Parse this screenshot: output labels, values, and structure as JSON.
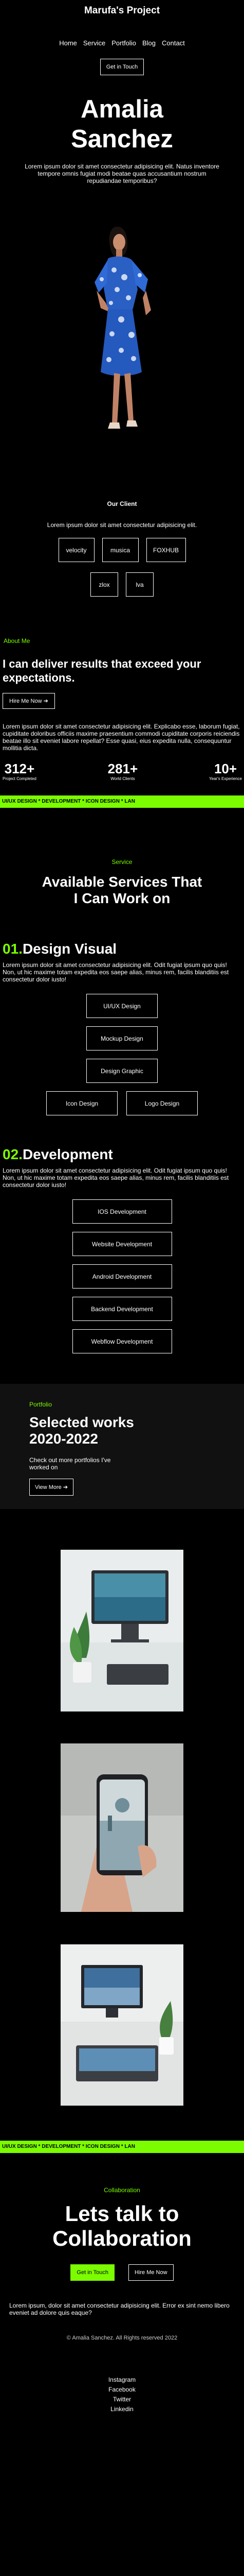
{
  "header": {
    "brand": "Marufa's Project",
    "nav": [
      "Home",
      "Service",
      "Portfolio",
      "Blog",
      "Contact"
    ],
    "cta": "Get in Touch"
  },
  "hero": {
    "name_line1": "Amalia",
    "name_line2": "Sanchez",
    "text": "Lorem ipsum dolor sit amet consectetur adipisicing elit. Natus inventore tempore omnis fugiat modi beatae quas accusantium nostrum repudiandae temporibus?"
  },
  "clients": {
    "title": "Our Client",
    "text": "Lorem ipsum dolor sit amet consectetur adipisicing elit.",
    "row1": [
      "velocity",
      "musica",
      "FOXHUB"
    ],
    "row2": [
      "zlox",
      "lva"
    ]
  },
  "about": {
    "label": "About Me",
    "title": "I can deliver results that exceed your expectations.",
    "cta": "Hire Me Now ➔",
    "text": "Lorem ipsum dolor sit amet consectetur adipisicing elit. Explicabo esse, laborum fugiat, cupiditate doloribus officiis maxime praesentium commodi cupiditate corporis reiciendis beatae illo sit eveniet labore repellat? Esse quasi, eius expedita nulla, consequuntur mollitia dicta.",
    "stats": [
      {
        "num": "312+",
        "label": "Project Completed"
      },
      {
        "num": "281+",
        "label": "World Clients"
      },
      {
        "num": "10+",
        "label": "Year's Experience"
      }
    ]
  },
  "marquee": "UI/UX DESIGN * DEVELOPMENT * ICON DESIGN * LAN",
  "services": {
    "label": "Service",
    "title_line1": "Available Services That",
    "title_line2": "I Can Work on",
    "design": {
      "num": "01.",
      "title": "Design Visual",
      "text": "Lorem ipsum dolor sit amet consectetur adipisicing elit. Odit fugiat ipsum quo quis! Non, ut hic maxime totam expedita eos saepe alias, minus rem, facilis blanditiis est consectetur dolor iusto!",
      "items": [
        "UI/UX Design",
        "Mockup Design",
        "Design Graphic"
      ],
      "row": [
        "Icon Design",
        "Logo Design"
      ]
    },
    "dev": {
      "num": "02.",
      "title": "Development",
      "text": "Lorem ipsum dolor sit amet consectetur adipisicing elit. Odit fugiat ipsum quo quis! Non, ut hic maxime totam expedita eos saepe alias, minus rem, facilis blanditiis est consectetur dolor iusto!",
      "items": [
        "IOS Development",
        "Website Development",
        "Android Development",
        "Backend Development",
        "Webflow Development"
      ]
    }
  },
  "portfolio": {
    "label": "Portfolio",
    "title_line1": "Selected works",
    "title_line2": "2020-2022",
    "text": "Check out more portfolios I've worked on",
    "cta": "View More ➔"
  },
  "collab": {
    "label": "Collaboration",
    "title_line1": "Lets talk to",
    "title_line2": "Collaboration",
    "btn_primary": "Get in Touch",
    "btn_secondary": "Hire Me Now",
    "text": "Lorem ipsum, dolor sit amet consectetur adipisicing elit. Error ex sint nemo libero eveniet ad dolore quis eaque?",
    "copyright": "© Amalia Sanchez. All Rights reserved 2022",
    "socials": [
      "Instagram",
      "Facebook",
      "Twitter",
      "Linkedin"
    ]
  },
  "colors": {
    "accent": "#7cfc00",
    "background": "#000000"
  }
}
